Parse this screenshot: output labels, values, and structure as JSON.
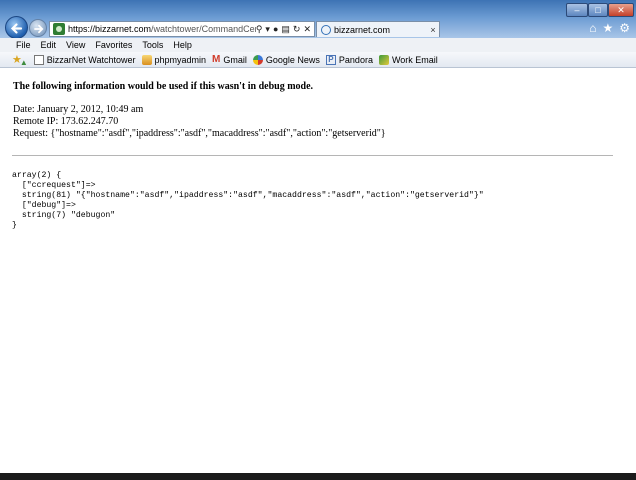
{
  "browser": {
    "address_url_host": "https://bizzarnet.com",
    "address_url_path": "/watchtower/CommandCenter.php",
    "tab_title": "bizzarnet.com",
    "tab_close": "×"
  },
  "menu": [
    "File",
    "Edit",
    "View",
    "Favorites",
    "Tools",
    "Help"
  ],
  "favorites": [
    {
      "label": "BizzarNet Watchtower",
      "icon": "doc-icon"
    },
    {
      "label": "phpmyadmin",
      "icon": "phpmyadmin-icon"
    },
    {
      "label": "Gmail",
      "icon": "gmail-icon"
    },
    {
      "label": "Google News",
      "icon": "google-news-icon"
    },
    {
      "label": "Pandora",
      "icon": "pandora-icon"
    },
    {
      "label": "Work Email",
      "icon": "mail-icon"
    }
  ],
  "page": {
    "heading": "The following information would be used if this wasn't in debug mode.",
    "date": "Date: January 2, 2012, 10:49 am",
    "remote_ip": "Remote IP: 173.62.247.70",
    "request": "Request: {\"hostname\":\"asdf\",\"ipaddress\":\"asdf\",\"macaddress\":\"asdf\",\"action\":\"getserverid\"}",
    "dump": "array(2) {\n  [\"ccrequest\"]=>\n  string(81) \"{\"hostname\":\"asdf\",\"ipaddress\":\"asdf\",\"macaddress\":\"asdf\",\"action\":\"getserverid\"}\"\n  [\"debug\"]=>\n  string(7) \"debugon\"\n}"
  }
}
